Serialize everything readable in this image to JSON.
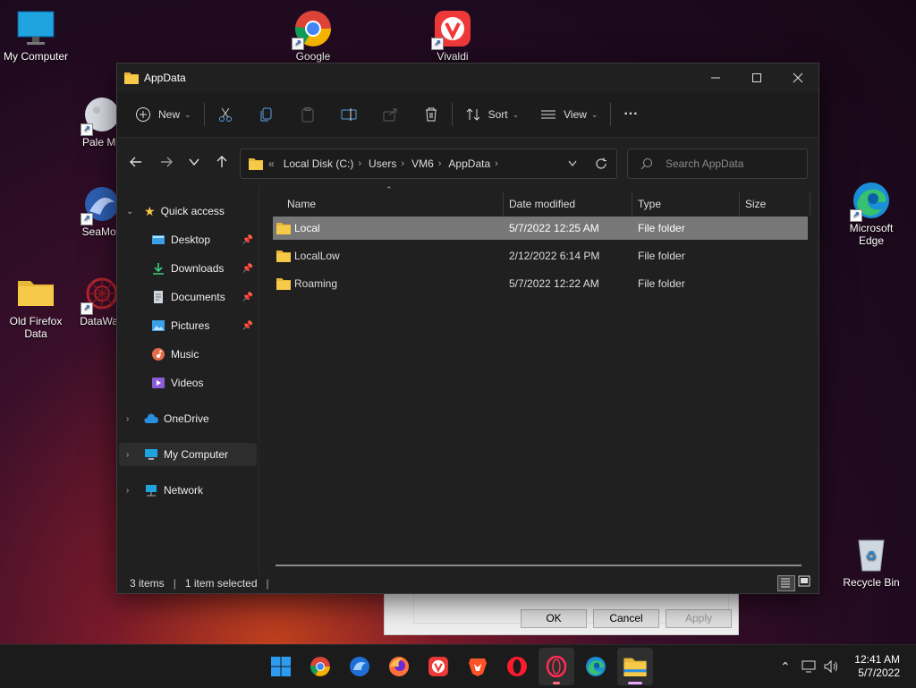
{
  "desktop": {
    "icons": [
      {
        "label": "My Computer"
      },
      {
        "label": "Google"
      },
      {
        "label": "Vivaldi"
      },
      {
        "label": "Pale Mo"
      },
      {
        "label": "SeaMon"
      },
      {
        "label": "Old Firefox Data"
      },
      {
        "label": "DataWag"
      },
      {
        "label": "Microsoft Edge"
      },
      {
        "label": "Recycle Bin"
      }
    ]
  },
  "window": {
    "title": "AppData",
    "toolbar": {
      "new_label": "New",
      "sort_label": "Sort",
      "view_label": "View",
      "more_label": "···"
    },
    "address": {
      "crumbs": [
        "Local Disk (C:)",
        "Users",
        "VM6",
        "AppData"
      ],
      "overflow": "«"
    },
    "search": {
      "placeholder": "Search AppData",
      "value": ""
    },
    "nav": {
      "quick_access": "Quick access",
      "items": [
        {
          "label": "Desktop",
          "pinned": true
        },
        {
          "label": "Downloads",
          "pinned": true
        },
        {
          "label": "Documents",
          "pinned": true
        },
        {
          "label": "Pictures",
          "pinned": true
        },
        {
          "label": "Music",
          "pinned": false
        },
        {
          "label": "Videos",
          "pinned": false
        }
      ],
      "onedrive": "OneDrive",
      "my_computer": "My Computer",
      "network": "Network"
    },
    "columns": [
      "Name",
      "Date modified",
      "Type",
      "Size"
    ],
    "rows": [
      {
        "name": "Local",
        "date": "5/7/2022 12:25 AM",
        "type": "File folder",
        "selected": true
      },
      {
        "name": "LocalLow",
        "date": "2/12/2022 6:14 PM",
        "type": "File folder",
        "selected": false
      },
      {
        "name": "Roaming",
        "date": "5/7/2022 12:22 AM",
        "type": "File folder",
        "selected": false
      }
    ],
    "status": {
      "count": "3 items",
      "selection": "1 item selected"
    }
  },
  "dialog": {
    "ok": "OK",
    "cancel": "Cancel",
    "apply": "Apply"
  },
  "taskbar": {
    "time": "12:41 AM",
    "date": "5/7/2022"
  },
  "colors": {
    "folder": "#f7c948",
    "accent": "#0078d4",
    "selected_row": "#777777"
  }
}
